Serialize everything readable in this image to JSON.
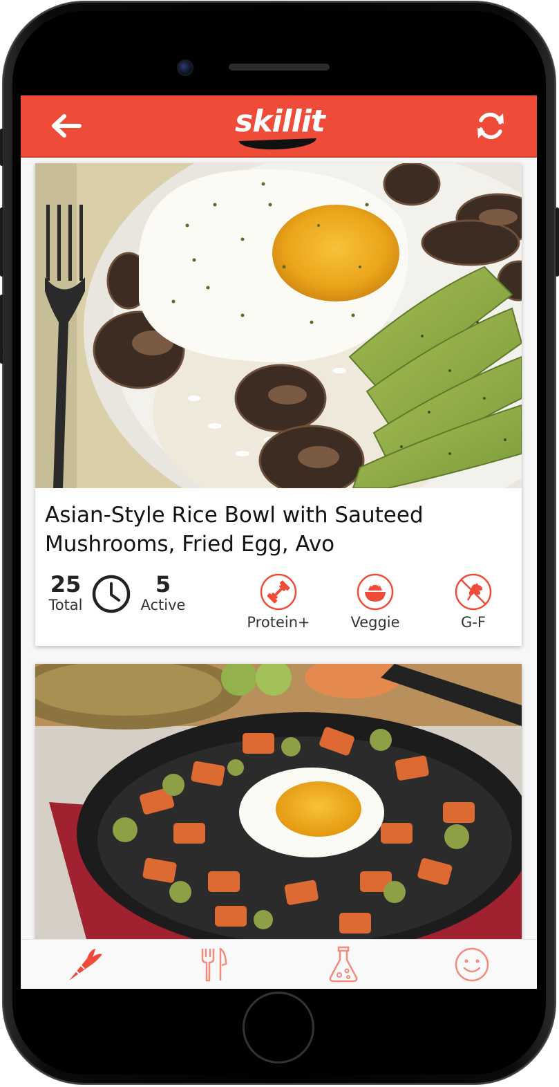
{
  "app": {
    "name": "skillit",
    "accent_color": "#ee4c38",
    "nav_inactive_color": "#f28a7d"
  },
  "header": {
    "back_icon": "arrow-left-icon",
    "refresh_icon": "refresh-icon"
  },
  "recipes": [
    {
      "title": "Asian-Style Rice Bowl with Sauteed Mushrooms, Fried Egg, Avo",
      "image": "photo of rice bowl with fried egg, sauteed mushrooms and sliced avocado",
      "total_time": "25",
      "total_label": "Total",
      "active_time": "5",
      "active_label": "Active",
      "tags": [
        {
          "label": "Protein+",
          "icon": "dumbbell-icon"
        },
        {
          "label": "Veggie",
          "icon": "bowl-icon"
        },
        {
          "label": "G-F",
          "icon": "no-wheat-icon"
        }
      ]
    },
    {
      "title": "",
      "image": "photo of cast-iron skillet with sweet potato, brussels sprouts and fried egg"
    }
  ],
  "bottom_nav": [
    {
      "icon": "carrot-icon",
      "active": true
    },
    {
      "icon": "fork-knife-icon",
      "active": false
    },
    {
      "icon": "flask-icon",
      "active": false
    },
    {
      "icon": "smiley-icon",
      "active": false
    }
  ]
}
